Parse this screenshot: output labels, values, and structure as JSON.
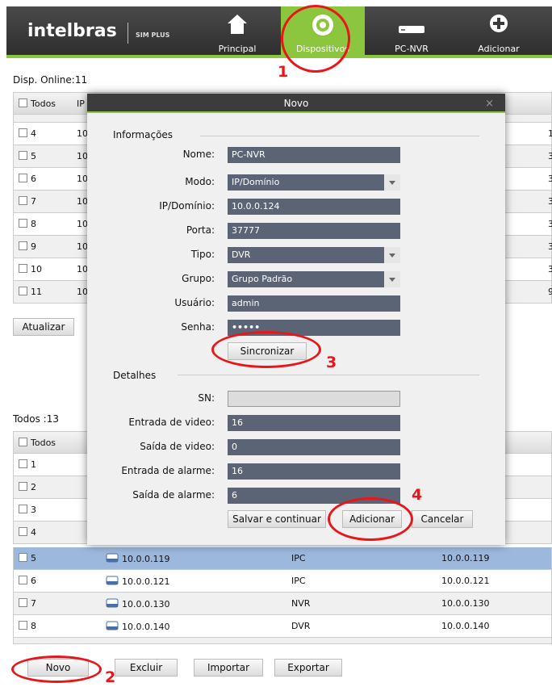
{
  "header": {
    "logo": "intelbras",
    "product": "SIM PLUS",
    "nav": [
      {
        "label": "Principal",
        "icon": "home-icon"
      },
      {
        "label": "Dispositivos",
        "icon": "camera-icon"
      },
      {
        "label": "PC-NVR",
        "icon": "nvr-device-icon"
      },
      {
        "label": "Adicionar",
        "icon": "plus-circle-icon"
      }
    ]
  },
  "online": {
    "title": "Disp. Online:11",
    "header_all": "Todos",
    "header_ip": "IP",
    "rows": [
      {
        "num": "4",
        "ip": "10",
        "last": "1"
      },
      {
        "num": "5",
        "ip": "10",
        "last": "3"
      },
      {
        "num": "6",
        "ip": "10",
        "last": "3"
      },
      {
        "num": "7",
        "ip": "10",
        "last": "3"
      },
      {
        "num": "8",
        "ip": "10",
        "last": "3"
      },
      {
        "num": "9",
        "ip": "10",
        "last": "3"
      },
      {
        "num": "10",
        "ip": "10",
        "last": "3"
      },
      {
        "num": "11",
        "ip": "10",
        "last": "9"
      }
    ],
    "refresh_label": "Atualizar"
  },
  "all": {
    "title": "Todos :13",
    "header_all": "Todos",
    "rows": [
      {
        "num": "1"
      },
      {
        "num": "2"
      },
      {
        "num": "3"
      },
      {
        "num": "4"
      },
      {
        "num": "5",
        "name": "10.0.0.119",
        "type": "IPC",
        "ip": "10.0.0.119"
      },
      {
        "num": "6",
        "name": "10.0.0.121",
        "type": "IPC",
        "ip": "10.0.0.121"
      },
      {
        "num": "7",
        "name": "10.0.0.130",
        "type": "NVR",
        "ip": "10.0.0.130"
      },
      {
        "num": "8",
        "name": "10.0.0.140",
        "type": "DVR",
        "ip": "10.0.0.140"
      }
    ],
    "buttons": {
      "novo": "Novo",
      "excluir": "Excluir",
      "importar": "Importar",
      "exportar": "Exportar"
    }
  },
  "modal": {
    "title": "Novo",
    "close": "×",
    "info_section": "Informações",
    "fields": {
      "nome": {
        "label": "Nome:",
        "value": "PC-NVR"
      },
      "modo": {
        "label": "Modo:",
        "value": "IP/Domínio"
      },
      "ip": {
        "label": "IP/Domínio:",
        "value": "10.0.0.124"
      },
      "porta": {
        "label": "Porta:",
        "value": "37777"
      },
      "tipo": {
        "label": "Tipo:",
        "value": "DVR"
      },
      "grupo": {
        "label": "Grupo:",
        "value": "Grupo Padrão"
      },
      "usuario": {
        "label": "Usuário:",
        "value": "admin"
      },
      "senha": {
        "label": "Senha:",
        "value": "•••••"
      }
    },
    "sync_label": "Sincronizar",
    "details_section": "Detalhes",
    "details": {
      "sn": {
        "label": "SN:",
        "value": ""
      },
      "entrada_video": {
        "label": "Entrada de video:",
        "value": "16"
      },
      "saida_video": {
        "label": "Saída de video:",
        "value": "0"
      },
      "entrada_alarme": {
        "label": "Entrada de alarme:",
        "value": "16"
      },
      "saida_alarme": {
        "label": "Saída de alarme:",
        "value": "6"
      }
    },
    "buttons": {
      "salvar": "Salvar e continuar",
      "adicionar": "Adicionar",
      "cancelar": "Cancelar"
    }
  },
  "annotations": [
    "1",
    "2",
    "3",
    "4"
  ],
  "colors": {
    "accent": "#8cc63f",
    "annotation": "#e8161b",
    "selected_row": "#9db8dd",
    "field": "#5a6475"
  }
}
